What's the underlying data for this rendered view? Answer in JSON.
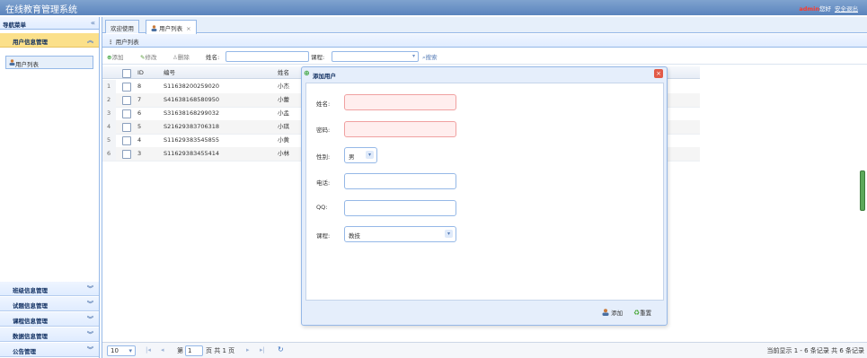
{
  "header": {
    "app_title": "在线教育管理系统",
    "username": "admin",
    "greeting": "您好",
    "logout": "安全退出"
  },
  "sidebar": {
    "title": "导航菜单",
    "collapse_icon": "double-chevron-left",
    "active_group": "用户信息管理",
    "active_item": "用户列表",
    "groups": [
      {
        "label": "班级信息管理"
      },
      {
        "label": "试题信息管理"
      },
      {
        "label": "课程信息管理"
      },
      {
        "label": "数据信息管理"
      },
      {
        "label": "公告管理"
      }
    ]
  },
  "tabs": [
    {
      "label": "欢迎使用"
    },
    {
      "label": "用户列表"
    }
  ],
  "panel_title": "用户列表",
  "toolbar": {
    "add": "添加",
    "edit": "修改",
    "delete": "删除",
    "name_label": "姓名:",
    "course_label": "课程:",
    "search": "搜索"
  },
  "grid": {
    "columns": [
      "ID",
      "编号",
      "姓名"
    ],
    "rows": [
      {
        "num": "1",
        "id": "8",
        "code": "S11638200259020",
        "name": "小杰"
      },
      {
        "num": "2",
        "id": "7",
        "code": "S41638168580950",
        "name": "小蕾"
      },
      {
        "num": "3",
        "id": "6",
        "code": "S31638168299032",
        "name": "小孟"
      },
      {
        "num": "4",
        "id": "5",
        "code": "S21629383706318",
        "name": "小琪"
      },
      {
        "num": "5",
        "id": "4",
        "code": "S11629383545855",
        "name": "小黄"
      },
      {
        "num": "6",
        "id": "3",
        "code": "S11629383455414",
        "name": "小林"
      }
    ]
  },
  "pager": {
    "page_size": "10",
    "page_prefix": "第",
    "page_value": "1",
    "page_suffix": "页 共 1 页",
    "summary": "当前显示 1 - 6 条记录 共 6 条记录"
  },
  "dialog": {
    "title": "添加用户",
    "fields": {
      "name_label": "姓名:",
      "password_label": "密码:",
      "gender_label": "性别:",
      "gender_value": "男",
      "phone_label": "电话:",
      "qq_label": "QQ:",
      "course_label": "课程:",
      "course_value": "教技"
    },
    "add_button": "添加",
    "reset_button": "重置"
  },
  "colors": {
    "header": "#5b84bd",
    "accent_border": "#95b8e7",
    "active_group": "#fbe08a",
    "username": "#ff3a2a"
  }
}
